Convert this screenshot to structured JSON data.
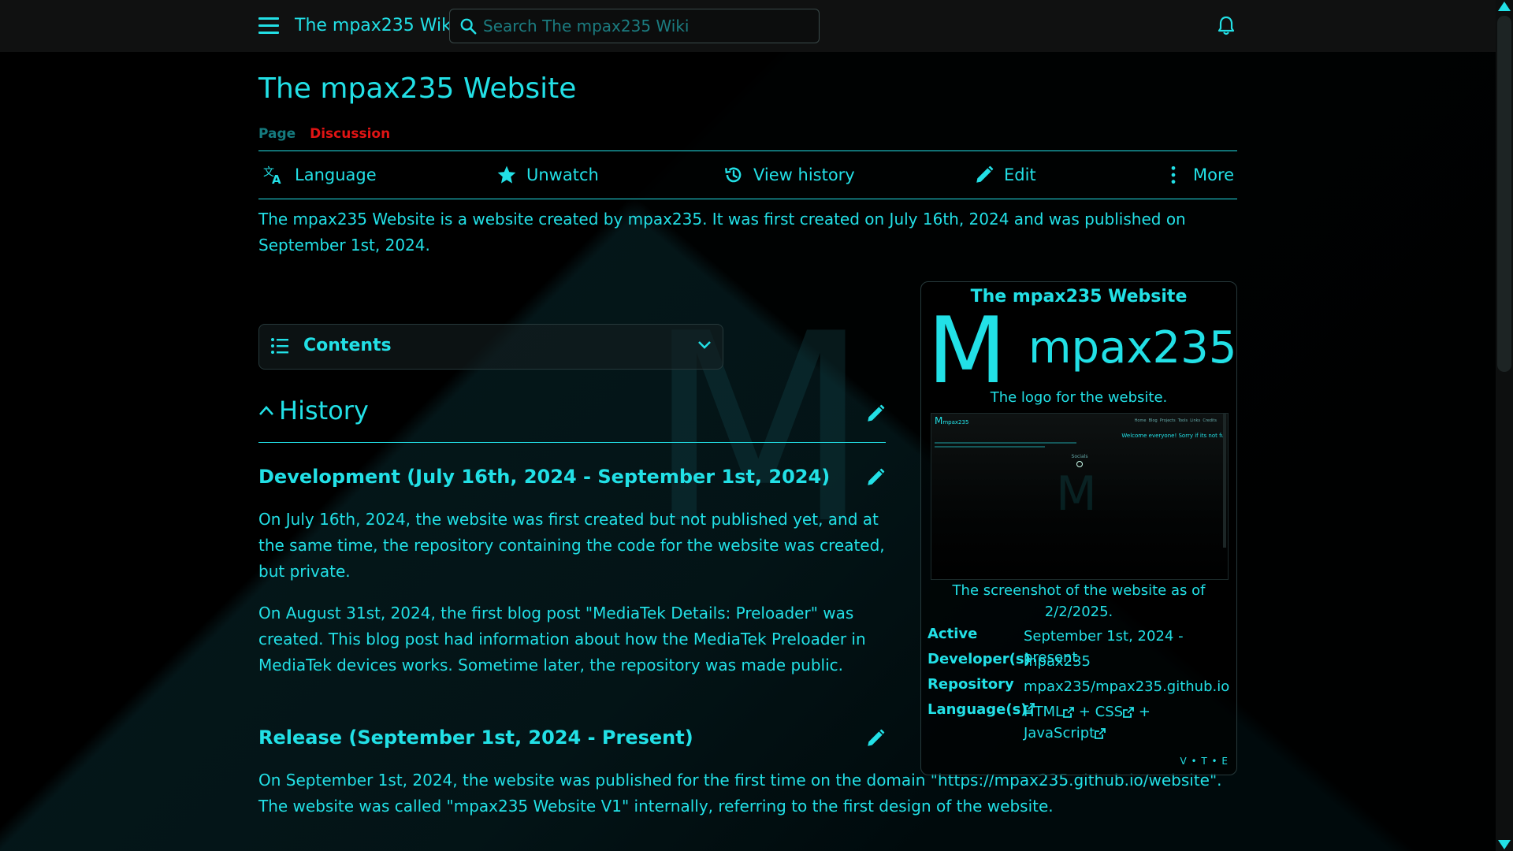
{
  "header": {
    "site_title": "The mpax235 Wiki",
    "search_placeholder": "Search The mpax235 Wiki"
  },
  "page": {
    "title": "The mpax235 Website",
    "tabs": [
      "Page",
      "Discussion"
    ],
    "actions": [
      "Language",
      "Unwatch",
      "View history",
      "Edit",
      "More"
    ],
    "intro": "The mpax235 Website is a website created by mpax235. It was first created on July 16th, 2024 and was published on September 1st, 2024."
  },
  "contents": {
    "label": "Contents"
  },
  "sections": {
    "history": {
      "title": "History"
    },
    "development": {
      "title": "Development (July 16th, 2024 - September 1st, 2024)",
      "para1": "On July 16th, 2024, the website was first created but not published yet, and at the same time, the repository containing the code for the website was created, but private.",
      "para2": "On August 31st, 2024, the first blog post \"MediaTek Details: Preloader\" was created. This blog post had information about how the MediaTek Preloader in MediaTek devices works. Sometime later, the repository was made public."
    },
    "release": {
      "title": "Release (September 1st, 2024 - Present)",
      "para1": "On September 1st, 2024, the website was published for the first time on the domain \"https://mpax235.github.io/website\". The website was called \"mpax235 Website V1\" internally, referring to the first design of the website."
    }
  },
  "infobox": {
    "title": "The mpax235 Website",
    "logo_letter": "M",
    "logo_text": "mpax235",
    "logo_caption": "The logo for the website.",
    "screenshot_caption": "The screenshot of the website as of 2/2/2025.",
    "screenshot": {
      "brand": "mpax235",
      "nav": [
        "Home",
        "Blog",
        "Projects",
        "Tools",
        "Links",
        "Credits"
      ],
      "welcome": "Welcome everyone! Sorry if its not fu",
      "socials_label": "Socials",
      "bg_letter": "M"
    },
    "rows": [
      {
        "key": "Active",
        "value": "September 1st, 2024 - present"
      },
      {
        "key": "Developer(s)",
        "value": "mpax235"
      },
      {
        "key": "Repository",
        "value": "mpax235/mpax235.github.io"
      },
      {
        "key": "Language(s)",
        "value_html": "HTML",
        "value_css": "CSS",
        "value_js": "JavaScript",
        "sep": "+"
      }
    ],
    "vte": "V • T • E"
  },
  "background_letter": "M",
  "colors": {
    "accent": "#22e0e6",
    "discussion": "#e01414",
    "background": "#000000"
  }
}
